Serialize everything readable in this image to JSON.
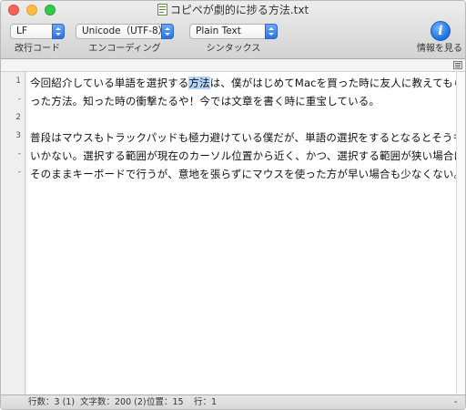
{
  "window": {
    "title": "コピペが劇的に捗る方法.txt"
  },
  "toolbar": {
    "line_ending": {
      "value": "LF",
      "label": "改行コード"
    },
    "encoding": {
      "value": "Unicode（UTF-8）",
      "label": "エンコーディング"
    },
    "syntax": {
      "value": "Plain Text",
      "label": "シンタックス"
    },
    "info": {
      "icon": "info-icon",
      "label": "情報を見る"
    }
  },
  "gutter": {
    "numbers": [
      "1",
      "-",
      "2",
      "3",
      "-",
      "-"
    ]
  },
  "editor": {
    "lines": [
      {
        "before": "今回紹介している単語を選択する",
        "selected": "方法",
        "after": "は、僕がはじめてMacを買った時に友人に教えてもら"
      },
      {
        "text": "った方法。知った時の衝撃たるや！今では文章を書く時に重宝している。"
      },
      {
        "text": ""
      },
      {
        "text": "普段はマウスもトラックパッドも極力避けている僕だが、単語の選択をするとなるとそうも"
      },
      {
        "text": "いかない。選択する範囲が現在のカーソル位置から近く、かつ、選択する範囲が狭い場合は"
      },
      {
        "text": "そのままキーボードで行うが、意地を張らずにマウスを使った方が早い場合も少なくない。"
      }
    ]
  },
  "status": {
    "lines": "行数：3 (1)",
    "chars": "文字数：200 (2)",
    "position": "位置：15",
    "row": "行：1",
    "right": "-"
  },
  "colors": {
    "selection": "#b5d5ff",
    "accent": "#2b73e5"
  }
}
